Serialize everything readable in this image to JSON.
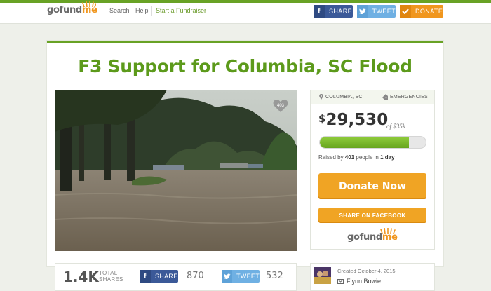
{
  "header": {
    "logo": {
      "part1": "gofund",
      "part2": "me"
    },
    "nav": [
      "Search",
      "Help",
      "Start a Fundraiser"
    ],
    "share_label": "SHARE",
    "tweet_label": "TWEET",
    "donate_label": "DONATE"
  },
  "campaign": {
    "title": "F3 Support for Columbia, SC Flood",
    "hearts": "403",
    "location": "COLUMBIA, SC",
    "category": "EMERGENCIES",
    "amount_symbol": "$",
    "amount": "29,530",
    "goal_text": "of $35k",
    "progress_fraction": 0.84,
    "raised_prefix": "Raised by ",
    "raised_people": "401",
    "raised_middle": " people in ",
    "raised_days": "1 day",
    "donate_now": "Donate Now",
    "share_on_facebook": "SHARE ON FACEBOOK"
  },
  "shares": {
    "total": "1.4K",
    "label_line1": "TOTAL",
    "label_line2": "SHARES",
    "fb_label": "SHARE",
    "fb_count": "870",
    "tw_label": "TWEET",
    "tw_count": "532"
  },
  "organizer": {
    "created": "Created October 4, 2015",
    "name": "Flynn Bowie"
  },
  "colors": {
    "brand_green": "#5c9a1b",
    "donate_orange": "#f0a424",
    "facebook": "#3b5998",
    "twitter": "#6fb0e3"
  }
}
